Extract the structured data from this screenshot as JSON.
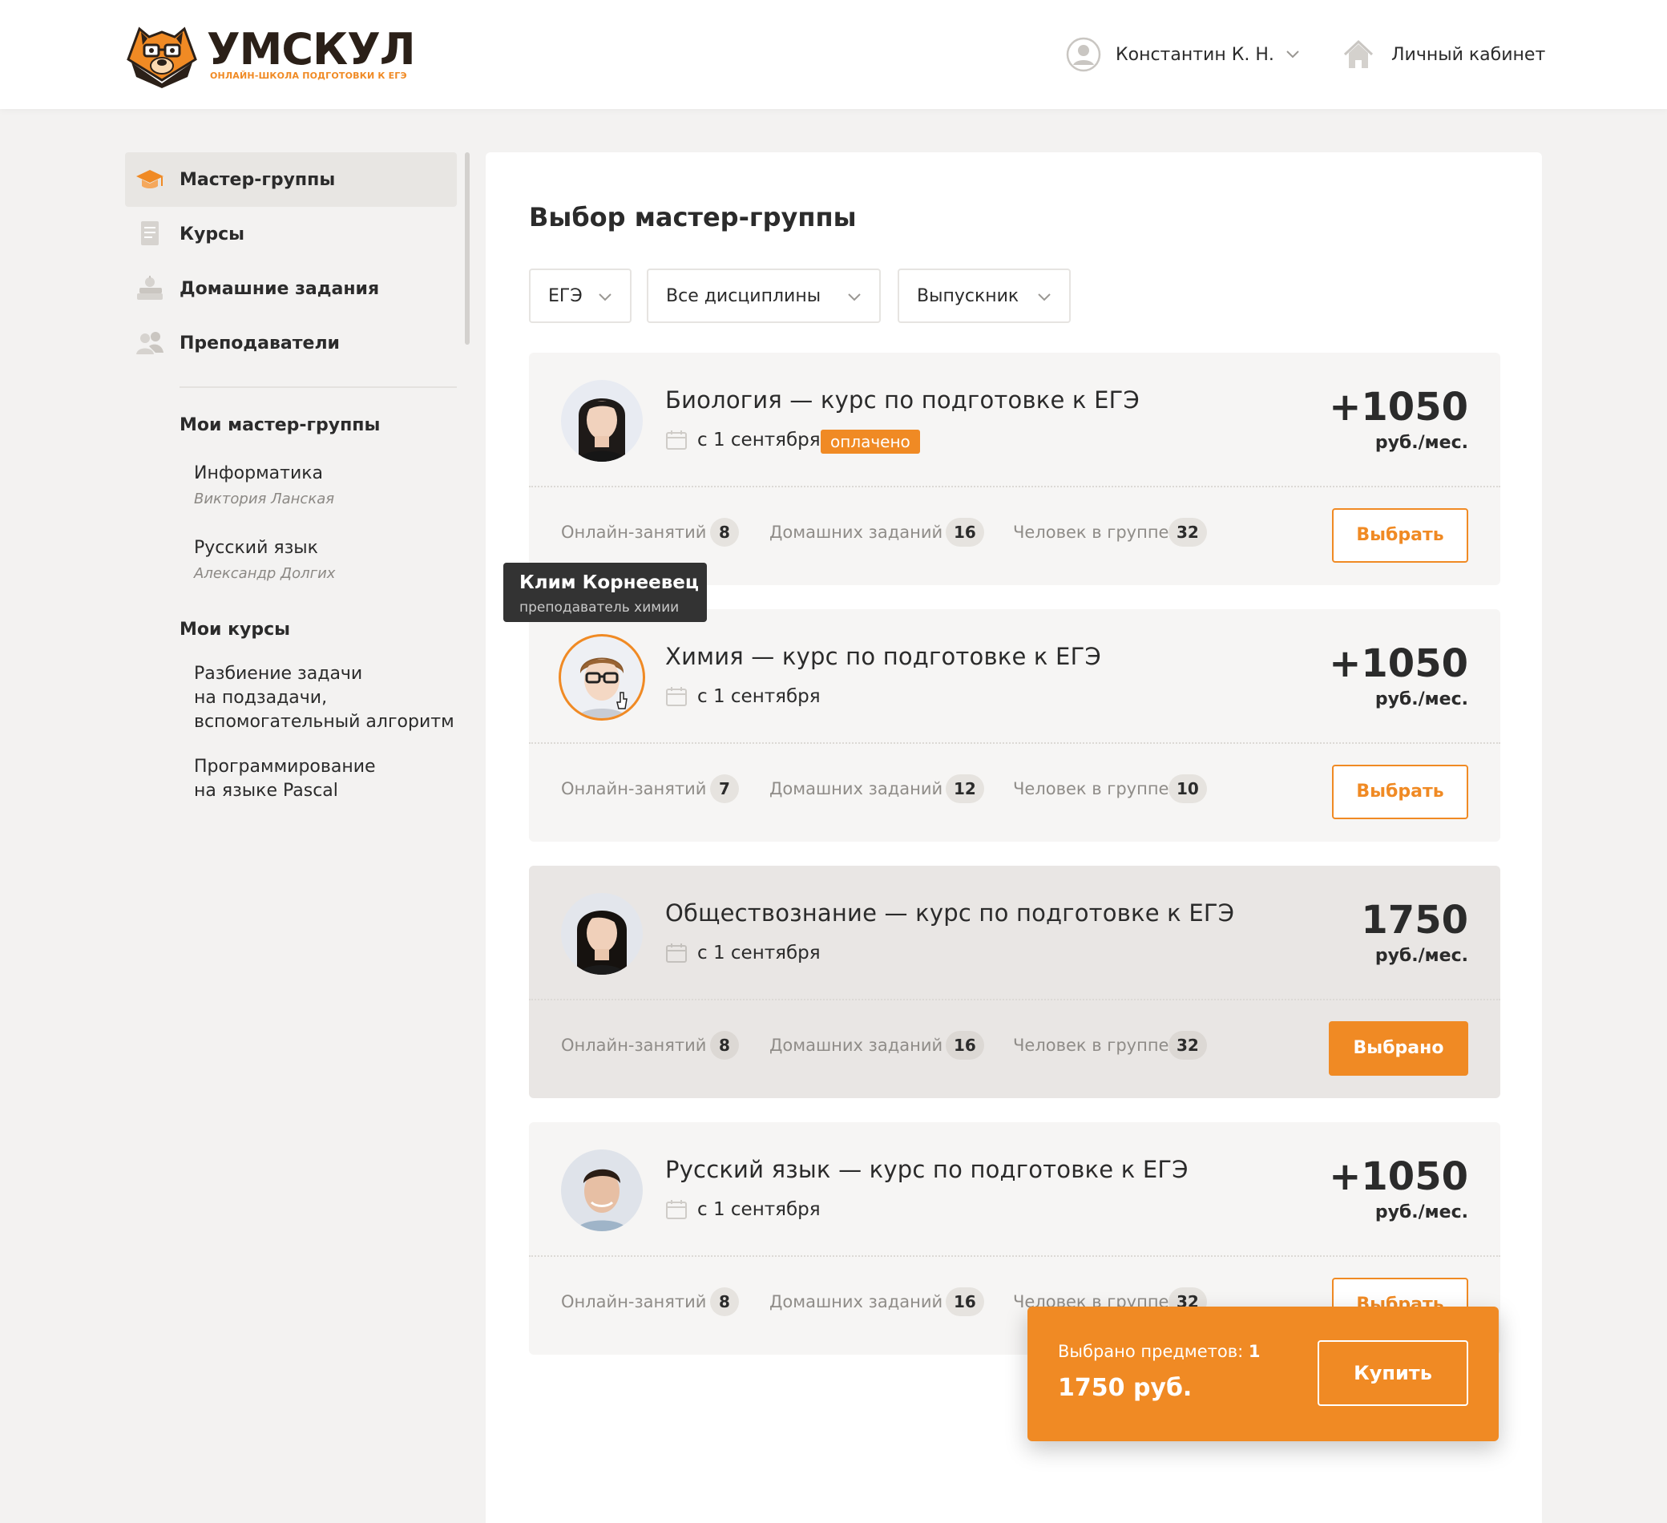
{
  "header": {
    "logo": {
      "name": "УМСКУЛ",
      "tagline": "ОНЛАЙН-ШКОЛА ПОДГОТОВКИ К ЕГЭ"
    },
    "user": {
      "name": "Константин К. Н.",
      "icon": "user-circle-icon"
    },
    "cabinet": {
      "label": "Личный кабинет",
      "icon": "home-icon"
    }
  },
  "colors": {
    "accent": "#f08a24",
    "text": "#2b2b2b",
    "muted": "#8f8c88",
    "page_bg": "#f3f2f1",
    "tooltip_bg": "#333333"
  },
  "sidebar": {
    "nav": [
      {
        "label": "Мастер-группы",
        "icon": "graduation-cap-icon",
        "active": true
      },
      {
        "label": "Курсы",
        "icon": "document-icon",
        "active": false
      },
      {
        "label": "Домашние задания",
        "icon": "books-apple-icon",
        "active": false
      },
      {
        "label": "Преподаватели",
        "icon": "people-icon",
        "active": false
      }
    ],
    "my_groups": {
      "title": "Мои мастер-группы",
      "items": [
        {
          "label": "Информатика",
          "teacher": "Виктория Ланская"
        },
        {
          "label": "Русский язык",
          "teacher": "Александр Долгих"
        }
      ]
    },
    "my_courses": {
      "title": "Мои курсы",
      "items": [
        {
          "lines": [
            "Разбиение задачи",
            "на подзадачи,",
            "вспомогательный алгоритм"
          ]
        },
        {
          "lines": [
            "Программирование",
            "на языке Pascal"
          ]
        }
      ]
    }
  },
  "main": {
    "title": "Выбор мастер-группы",
    "filters": [
      {
        "label": "ЕГЭ"
      },
      {
        "label": "Все дисциплины"
      },
      {
        "label": "Выпускник"
      }
    ],
    "stat_labels": {
      "online": "Онлайн-занятий",
      "homework": "Домашних заданий",
      "group": "Человек в группе"
    },
    "courses": [
      {
        "title": "Биология — курс по подготовке к ЕГЭ",
        "date": "с 1 сентября",
        "paid": "оплачено",
        "price": "+1050",
        "per": "руб./мес.",
        "online": "8",
        "homework": "16",
        "group": "32",
        "button": "Выбрать",
        "selected": false
      },
      {
        "title": "Химия — курс по подготовке к ЕГЭ",
        "date": "с 1 сентября",
        "price": "+1050",
        "per": "руб./мес.",
        "online": "7",
        "homework": "12",
        "group": "10",
        "button": "Выбрать",
        "selected": false
      },
      {
        "title": "Обществознание — курс по подготовке к ЕГЭ",
        "date": "с 1 сентября",
        "price": "1750",
        "per": "руб./мес.",
        "online": "8",
        "homework": "16",
        "group": "32",
        "button": "Выбрано",
        "selected": true
      },
      {
        "title": "Русский язык — курс по подготовке к ЕГЭ",
        "date": "с 1 сентября",
        "price": "+1050",
        "per": "руб./мес.",
        "online": "8",
        "homework": "16",
        "group": "32",
        "button": "Выбрать",
        "selected": false
      }
    ],
    "tooltip": {
      "name": "Клим Корнеевец",
      "role": "преподаватель химии"
    },
    "cart": {
      "count_label": "Выбрано предметов:",
      "count": "1",
      "total": "1750 руб.",
      "buy": "Купить"
    }
  }
}
